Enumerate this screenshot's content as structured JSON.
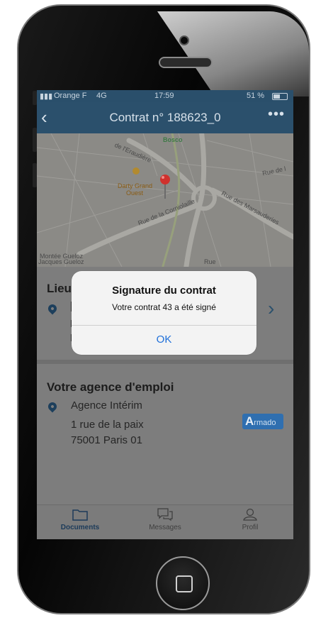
{
  "status_bar": {
    "carrier": "Orange F",
    "network": "4G",
    "time": "17:59",
    "battery": "51 %"
  },
  "navbar": {
    "title": "Contrat n° 188623_0",
    "more": "•••"
  },
  "map": {
    "labels": {
      "bosco": "Bosco",
      "darty_1": "Darty Grand",
      "darty_2": "Ouest",
      "rue_feraudiere": "de l'Eraudière",
      "rue_corniolaille": "Rue de la Corniolaille",
      "rue_marsauderies": "Rue des Marsauderies",
      "rue_le": "Rue de l",
      "montee": "Montée Gueloz",
      "jacques": "Jacques Gueloz",
      "rue_bottom": "Rue"
    }
  },
  "lieu": {
    "title": "Lieu"
  },
  "agence": {
    "title": "Votre agence d'emploi",
    "name": "Agence Intérim",
    "address_line1": "1 rue de la paix",
    "address_line2": "75001 Paris 01",
    "logo_letter": "A",
    "logo_text": "rmado"
  },
  "tabs": [
    {
      "label": "Documents",
      "icon": "folder-icon",
      "active": true
    },
    {
      "label": "Messages",
      "icon": "chat-icon",
      "active": false
    },
    {
      "label": "Profil",
      "icon": "person-icon",
      "active": false
    }
  ],
  "alert": {
    "title": "Signature du contrat",
    "message": "Votre contrat 43 a été signé",
    "ok_label": "OK"
  },
  "colors": {
    "navbar": "#2b506c",
    "pin": "#1d3f5c",
    "alert_button": "#1e6fd9",
    "map_marker": "#d0312d"
  }
}
